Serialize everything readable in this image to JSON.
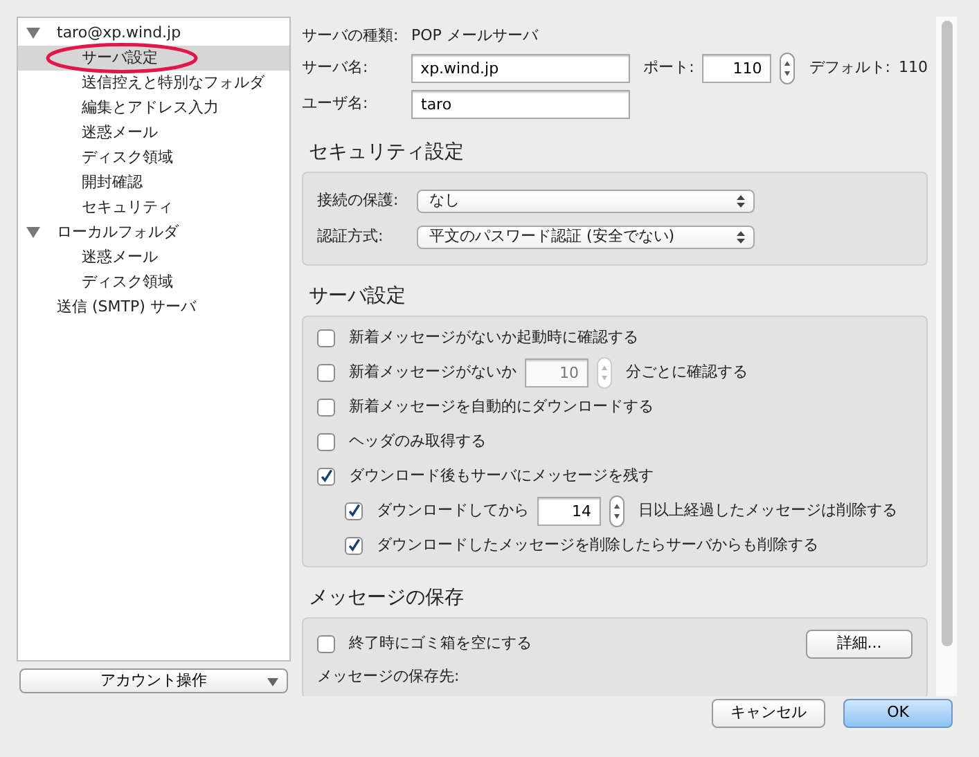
{
  "sidebar": {
    "tree": [
      {
        "label": "taro@xp.wind.jp",
        "selected": false,
        "expanded": true,
        "children": [
          {
            "label": "サーバ設定",
            "selected": true,
            "annotated": true
          },
          {
            "label": "送信控えと特別なフォルダ",
            "selected": false
          },
          {
            "label": "編集とアドレス入力",
            "selected": false
          },
          {
            "label": "迷惑メール",
            "selected": false
          },
          {
            "label": "ディスク領域",
            "selected": false
          },
          {
            "label": "開封確認",
            "selected": false
          },
          {
            "label": "セキュリティ",
            "selected": false
          }
        ]
      },
      {
        "label": "ローカルフォルダ",
        "selected": false,
        "expanded": true,
        "children": [
          {
            "label": "迷惑メール",
            "selected": false
          },
          {
            "label": "ディスク領域",
            "selected": false
          }
        ]
      },
      {
        "label": "送信 (SMTP) サーバ",
        "selected": false
      }
    ],
    "account_button": "アカウント操作"
  },
  "server_type": {
    "label": "サーバの種類:",
    "value": "POP メールサーバ"
  },
  "server_name": {
    "label": "サーバ名:",
    "value": "xp.wind.jp"
  },
  "port": {
    "label": "ポート:",
    "value": "110"
  },
  "default_port": {
    "label": "デフォルト:",
    "value": "110"
  },
  "user_name": {
    "label": "ユーザ名:",
    "value": "taro"
  },
  "security": {
    "title": "セキュリティ設定",
    "rows": [
      {
        "label": "接続の保護:",
        "value": "なし"
      },
      {
        "label": "認証方式:",
        "value": "平文のパスワード認証 (安全でない)"
      }
    ]
  },
  "server_settings": {
    "title": "サーバ設定",
    "options": [
      {
        "kind": "check",
        "label": "新着メッセージがないか起動時に確認する",
        "checked": false
      },
      {
        "kind": "check_spin",
        "label": "新着メッセージがないか",
        "value": "10",
        "after": "分ごとに確認する",
        "checked": false,
        "disabled": true
      },
      {
        "kind": "check",
        "label": "新着メッセージを自動的にダウンロードする",
        "checked": false
      },
      {
        "kind": "check",
        "label": "ヘッダのみ取得する",
        "checked": false
      },
      {
        "kind": "check",
        "label": "ダウンロード後もサーバにメッセージを残す",
        "checked": true,
        "children": [
          {
            "kind": "check_spin",
            "label": "ダウンロードしてから",
            "value": "14",
            "after": "日以上経過したメッセージは削除する",
            "checked": true,
            "disabled": false
          },
          {
            "kind": "check",
            "label": "ダウンロードしたメッセージを削除したらサーバからも削除する",
            "checked": true
          }
        ]
      }
    ]
  },
  "storage": {
    "title": "メッセージの保存",
    "empty_trash": {
      "label": "終了時にゴミ箱を空にする",
      "checked": false
    },
    "details_button": "詳細...",
    "location_label": "メッセージの保存先:"
  },
  "buttons": [
    {
      "label": "キャンセル",
      "default": false
    },
    {
      "label": "OK",
      "default": true
    }
  ]
}
